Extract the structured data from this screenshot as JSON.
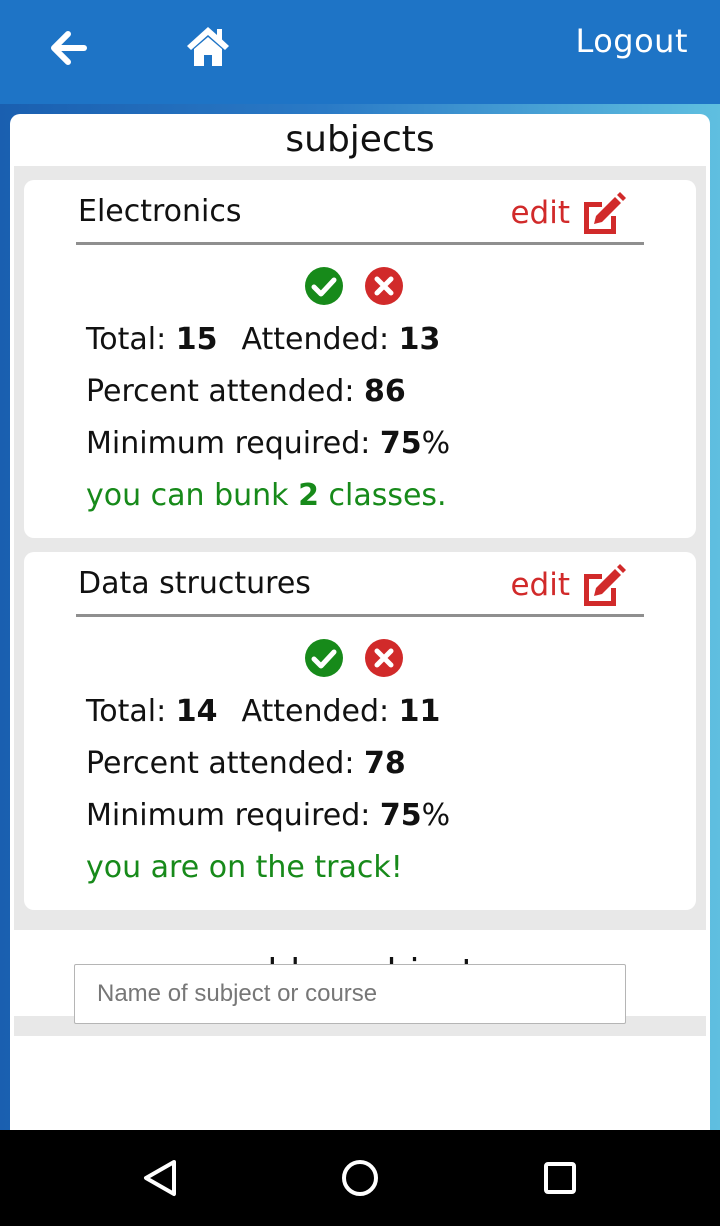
{
  "header": {
    "back_icon": "arrow-left-icon",
    "home_icon": "home-icon",
    "logout_label": "Logout"
  },
  "subjects_title": "subjects",
  "subjects": [
    {
      "name": "Electronics",
      "edit_label": "edit",
      "total_label": "Total:",
      "total": "15",
      "attended_label": "Attended:",
      "attended": "13",
      "percent_label": "Percent attended:",
      "percent": "86",
      "min_label": "Minimum required:",
      "min_value": "75",
      "min_unit": "%",
      "status_prefix": "you can bunk ",
      "status_number": "2",
      "status_suffix": " classes."
    },
    {
      "name": "Data structures",
      "edit_label": "edit",
      "total_label": "Total:",
      "total": "14",
      "attended_label": "Attended:",
      "attended": "11",
      "percent_label": "Percent attended:",
      "percent": "78",
      "min_label": "Minimum required:",
      "min_value": "75",
      "min_unit": "%",
      "status_prefix": "you are on the track!",
      "status_number": "",
      "status_suffix": ""
    }
  ],
  "add_title": "add a subject:",
  "add_input": {
    "placeholder": "Name of subject or course",
    "value": ""
  },
  "colors": {
    "header": "#1e74c6",
    "edit": "#d12a2a",
    "present": "#178a1a",
    "absent": "#d12a2a",
    "status": "#178a1a"
  },
  "icons": {
    "present": "check-circle-icon",
    "absent": "x-circle-icon",
    "edit": "edit-square-icon"
  },
  "navbar": {
    "back": "nav-back-icon",
    "home": "nav-home-icon",
    "recents": "nav-recents-icon"
  }
}
